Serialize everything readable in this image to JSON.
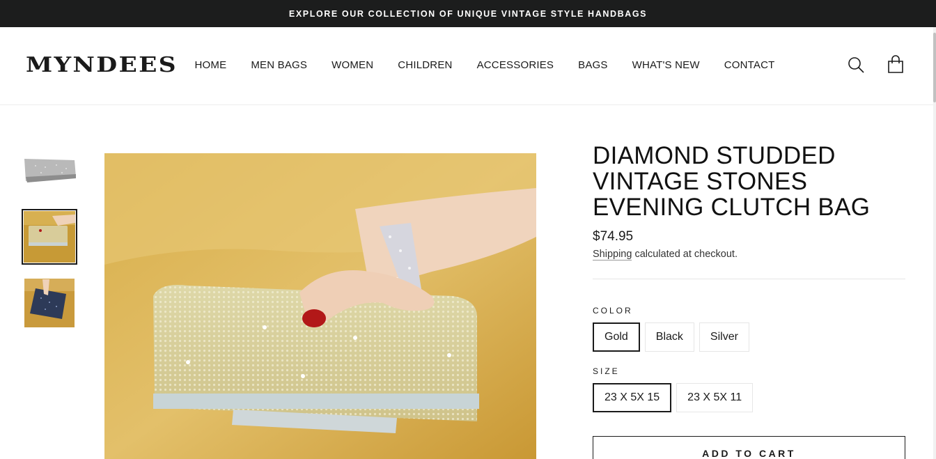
{
  "announcement": "EXPLORE OUR COLLECTION OF UNIQUE VINTAGE STYLE HANDBAGS",
  "brand": "MYNDEES",
  "nav": [
    "HOME",
    "MEN BAGS",
    "WOMEN",
    "CHILDREN",
    "ACCESSORIES",
    "BAGS",
    "WHAT'S NEW",
    "CONTACT"
  ],
  "header_icons": {
    "search": "search-icon",
    "cart": "shopping-bag-icon"
  },
  "gallery": {
    "thumbnails": [
      "silver-clutch",
      "gold-clutch-in-hand",
      "black-clutch-in-hand"
    ],
    "selected_index": 1
  },
  "product": {
    "title": "DIAMOND STUDDED VINTAGE STONES EVENING CLUTCH BAG",
    "price": "$74.95",
    "shipping_link": "Shipping",
    "shipping_rest": " calculated at checkout.",
    "color_label": "COLOR",
    "colors": [
      "Gold",
      "Black",
      "Silver"
    ],
    "color_selected": "Gold",
    "size_label": "SIZE",
    "sizes": [
      "23 X 5X 15",
      "23 X 5X 11"
    ],
    "size_selected": "23 X 5X 15",
    "add_to_cart": "ADD TO CART"
  }
}
